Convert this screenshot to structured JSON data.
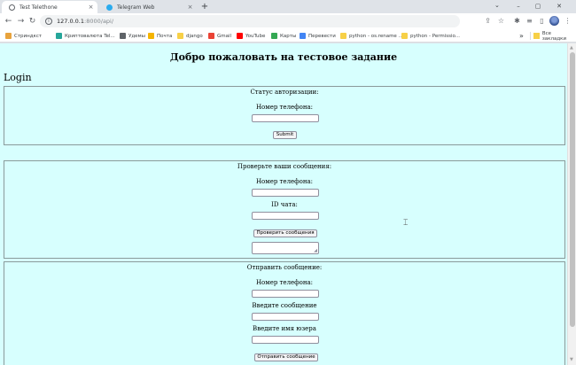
{
  "browser": {
    "tabs": [
      {
        "title": "Test Telethone",
        "active": true,
        "favicon_color": "#5f6368"
      },
      {
        "title": "Telegram Web",
        "active": false,
        "favicon_color": "#2aabee"
      }
    ],
    "new_tab_label": "+",
    "tab_close_glyph": "×",
    "tab_search_glyph": "⌄",
    "window_controls": {
      "minimize": "–",
      "maximize": "▢",
      "close": "✕"
    },
    "url_host": "127.0.0.1",
    "url_rest": ":8000/api/",
    "icons": [
      "back-icon",
      "forward-icon",
      "reload-icon",
      "site-info-icon",
      "share-icon",
      "star-icon",
      "extensions-icon",
      "media-icon",
      "side-panel-icon",
      "profile-avatar",
      "menu-icon"
    ],
    "nav_glyphs": {
      "back": "←",
      "forward": "→",
      "reload": "↻"
    },
    "toolbar_glyphs": {
      "share": "⇪",
      "star": "☆",
      "extensions": "✱",
      "media": "≡",
      "side_panel": "▯",
      "menu": "⋮"
    },
    "bookmarks": [
      {
        "label": "Стриндкст",
        "color": "#e8a33d"
      },
      {
        "label": "Криптовалюта Tel...",
        "color": "#26a69a"
      },
      {
        "label": "Удемы",
        "color": "#5f6368"
      },
      {
        "label": "Почта",
        "color": "#f5b400"
      },
      {
        "label": "django",
        "color": "#f7d047"
      },
      {
        "label": "Gmail",
        "color": "#ea4335"
      },
      {
        "label": "YouTube",
        "color": "#ff0000"
      },
      {
        "label": "Карты",
        "color": "#34a853"
      },
      {
        "label": "Перевести",
        "color": "#4285f4"
      },
      {
        "label": "python - os.rename ...",
        "color": "#f7d047"
      },
      {
        "label": "python - Permissio...",
        "color": "#f7d047"
      }
    ],
    "bookmarks_overflow": "»",
    "all_bookmarks_label": "Все закладки"
  },
  "page": {
    "title": "Добро пожаловать на тестовое задание",
    "login_heading": "Login",
    "auth_section": {
      "status_label": "Статус авторизации:",
      "phone_label": "Номер телефона:",
      "phone_value": "",
      "submit_label": "Submit"
    },
    "check_section": {
      "heading": "Проверьте ваши сообщения:",
      "phone_label": "Номер телефона:",
      "phone_value": "",
      "chat_id_label": "ID чата:",
      "chat_id_value": "",
      "button_label": "Проверить сообщения",
      "output_value": ""
    },
    "send_section": {
      "heading": "Отправить сообщение:",
      "phone_label": "Номер телефона:",
      "phone_value": "",
      "message_label": "Введите сообщение",
      "message_value": "",
      "username_label": "Введите имя юзера",
      "username_value": "",
      "button_label": "Отправить сообщение"
    }
  }
}
